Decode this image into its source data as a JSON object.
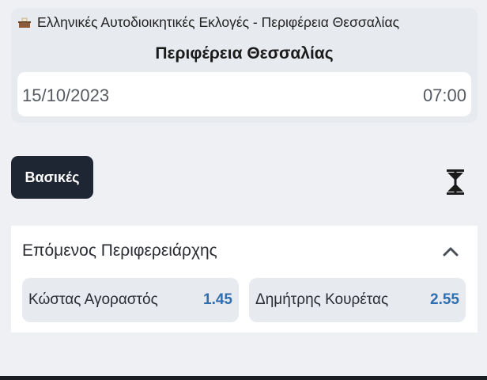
{
  "event": {
    "competition": "Ελληνικές Αυτοδιοικητικές Εκλογές - Περιφέρεια Θεσσαλίας",
    "competition_icon": "ballot-box-icon",
    "title": "Περιφέρεια Θεσσαλίας",
    "date": "15/10/2023",
    "time": "07:00"
  },
  "filters": {
    "active_label": "Βασικές",
    "collapse_icon": "collapse-all-icon"
  },
  "market": {
    "title": "Επόμενος Περιφερειάρχης",
    "chevron_icon": "chevron-up-icon",
    "outcomes": [
      {
        "name": "Κώστας Αγοραστός",
        "odds": "1.45"
      },
      {
        "name": "Δημήτρης Κουρέτας",
        "odds": "2.55"
      }
    ]
  },
  "colors": {
    "accent_odds": "#2f6fb0",
    "chip_bg": "#1f2633",
    "page_bg": "#eef0f4"
  }
}
